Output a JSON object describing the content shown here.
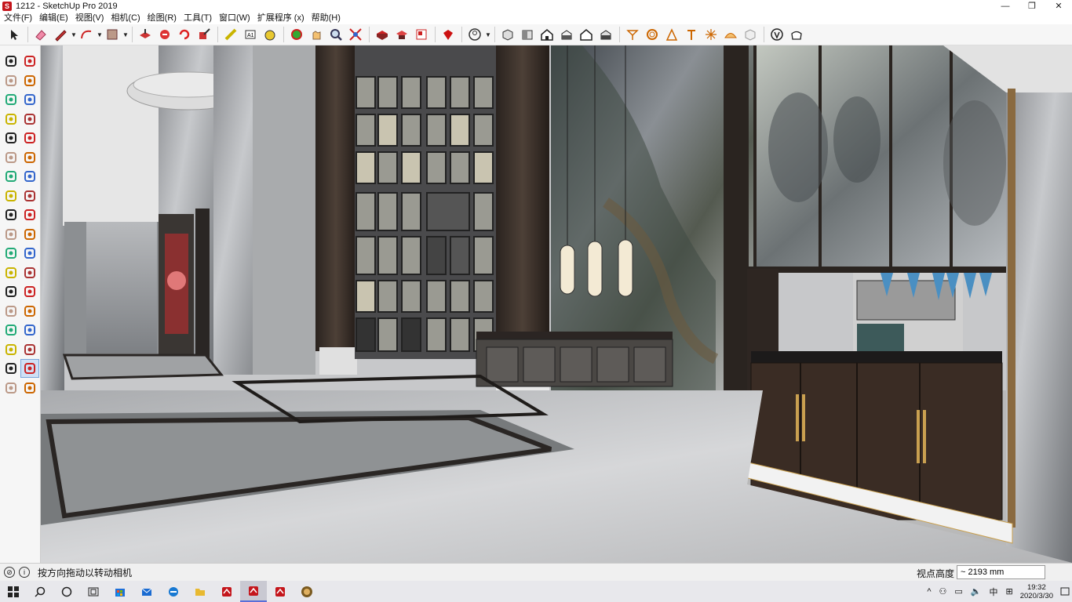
{
  "window": {
    "title": "1212 - SketchUp Pro 2019",
    "controls": [
      "—",
      "❐",
      "✕"
    ]
  },
  "menu": [
    "文件(F)",
    "编辑(E)",
    "视图(V)",
    "相机(C)",
    "绘图(R)",
    "工具(T)",
    "窗口(W)",
    "扩展程序 (x)",
    "帮助(H)"
  ],
  "toolbar_icons": [
    "select-icon",
    "eraser-icon",
    "pencil-icon",
    "arc-icon",
    "rectangle-icon",
    "push-pull-icon",
    "follow-me-icon",
    "rotate-icon",
    "scale-icon",
    "tape-measure-icon",
    "text-icon",
    "paint-bucket-icon",
    "orbit-icon",
    "pan-icon",
    "zoom-icon",
    "zoom-extents-icon",
    "warehouse-icon",
    "extension-warehouse-icon",
    "layout-icon",
    "ruby-icon",
    "account-icon",
    "iso-view-icon",
    "top-view-icon",
    "front-view-icon",
    "right-view-icon",
    "back-view-icon",
    "left-view-icon",
    "bottom-view-icon",
    "section-plane-icon",
    "sandbox-icon",
    "component-icon",
    "style-icon",
    "xray-icon",
    "hidden-line-icon",
    "shaded-icon",
    "textured-icon",
    "monochrome-icon"
  ],
  "left_tools": [
    "select-icon",
    "component-icon",
    "paint-bucket-icon",
    "eraser-icon",
    "line-icon",
    "freehand-icon",
    "rectangle-icon",
    "rotated-rect-icon",
    "circle-icon",
    "polygon-icon",
    "arc-icon",
    "pie-icon",
    "two-point-arc-icon",
    "three-point-arc-icon",
    "move-icon",
    "push-pull-icon",
    "rotate-icon",
    "follow-me-icon",
    "scale-icon",
    "offset-icon",
    "tape-measure-icon",
    "dimension-icon",
    "protractor-icon",
    "text-icon",
    "axes-icon",
    "3d-text-icon",
    "orbit-icon",
    "pan-icon",
    "zoom-icon",
    "zoom-window-icon",
    "zoom-extents-icon",
    "previous-view-icon",
    "position-camera-icon",
    "look-around-icon",
    "walk-icon",
    "section-plane-icon"
  ],
  "status": {
    "hint": "按方向拖动以转动相机",
    "measure_label": "视点高度",
    "measure_value": "~ 2193 mm"
  },
  "tray": {
    "time": "19:32",
    "date": "2020/3/30",
    "ime": "中"
  },
  "colors": {
    "accent": "#c4161c",
    "toolbar_bg": "#f6f6f6",
    "taskbar_bg": "#e8e8ec"
  }
}
